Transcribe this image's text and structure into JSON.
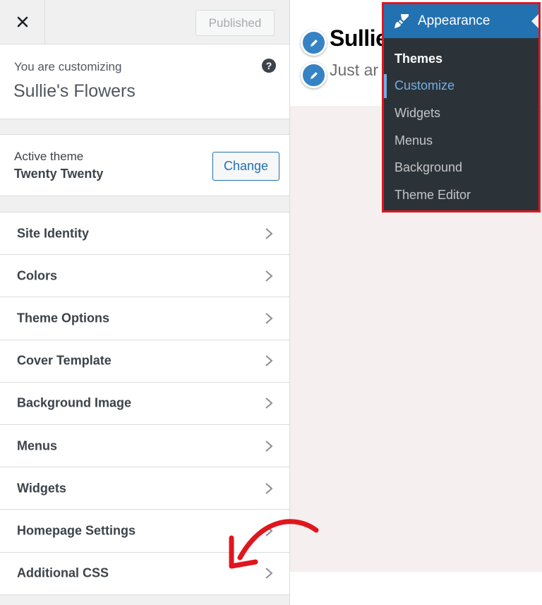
{
  "topbar": {
    "close_icon": "close-icon",
    "published_label": "Published"
  },
  "info": {
    "customizing_label": "You are customizing",
    "site_name": "Sullie's Flowers",
    "help_icon": "question-icon",
    "help_glyph": "?"
  },
  "theme": {
    "label": "Active theme",
    "name": "Twenty Twenty",
    "change_label": "Change"
  },
  "sections": [
    {
      "label": "Site Identity"
    },
    {
      "label": "Colors"
    },
    {
      "label": "Theme Options"
    },
    {
      "label": "Cover Template"
    },
    {
      "label": "Background Image"
    },
    {
      "label": "Menus"
    },
    {
      "label": "Widgets"
    },
    {
      "label": "Homepage Settings"
    },
    {
      "label": "Additional CSS"
    }
  ],
  "preview": {
    "site_title": "Sullie",
    "tagline": "Just ar",
    "edit_icon": "pencil-icon"
  },
  "appearance_menu": {
    "title": "Appearance",
    "icon": "paintbrush-icon",
    "items": [
      {
        "label": "Themes"
      },
      {
        "label": "Customize"
      },
      {
        "label": "Widgets"
      },
      {
        "label": "Menus"
      },
      {
        "label": "Background"
      },
      {
        "label": "Theme Editor"
      }
    ]
  },
  "colors": {
    "accent": "#2271b1",
    "menu_bg": "#2c3338",
    "highlight_border": "#e0161e",
    "annotation_arrow": "#e0161e"
  }
}
